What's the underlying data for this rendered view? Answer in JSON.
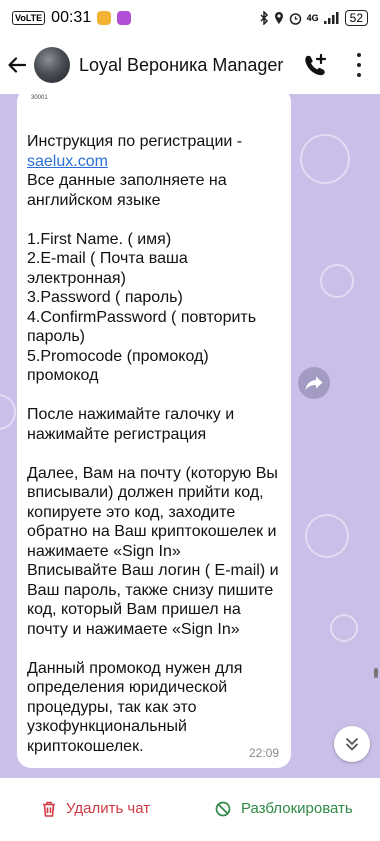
{
  "status_bar": {
    "volte": "VoLTE",
    "time": "00:31",
    "network": "4G",
    "battery": "52"
  },
  "header": {
    "title": "Loyal Вероника Manager"
  },
  "message": {
    "tiny_lines": [
      "...",
      "30001"
    ],
    "line1": "Инструкция по регистрации -",
    "link": "saelux.com",
    "body": "Все данные заполняете на английском языке\n\n1.First Name. ( имя)\n2.E-mail ( Почта ваша электронная)\n3.Password ( пароль)\n4.ConfirmPassword ( повторить пароль)\n5.Promocode (промокод) промокод\n\nПосле нажимайте галочку и нажимайте регистрация\n\nДалее, Вам на почту (которую Вы вписывали) должен прийти код, копируете это код, заходите обратно на Ваш криптокошелек и нажимаете «Sign In»\nВписывайте Ваш логин ( E-mail) и Ваш пароль, также снизу пишите код, который Вам пришел на почту и нажимаете «Sign In»\n\nДанный промокод нужен для определения юридической процедуры, так как это узкофункциональный криптокошелек.",
    "time": "22:09"
  },
  "bottom_bar": {
    "delete_label": "Удалить чат",
    "unblock_label": "Разблокировать"
  },
  "colors": {
    "chat_background": "#c9bfe8",
    "link": "#2b6fd6",
    "delete": "#d43a44",
    "unblock": "#2f8a45"
  },
  "icons": {
    "back": "arrow-left-icon",
    "call": "add-call-icon",
    "menu": "more-vertical-icon",
    "forward": "forward-icon",
    "scroll_down": "chevron-double-down-icon",
    "delete": "trash-icon",
    "unblock": "unblock-icon"
  }
}
